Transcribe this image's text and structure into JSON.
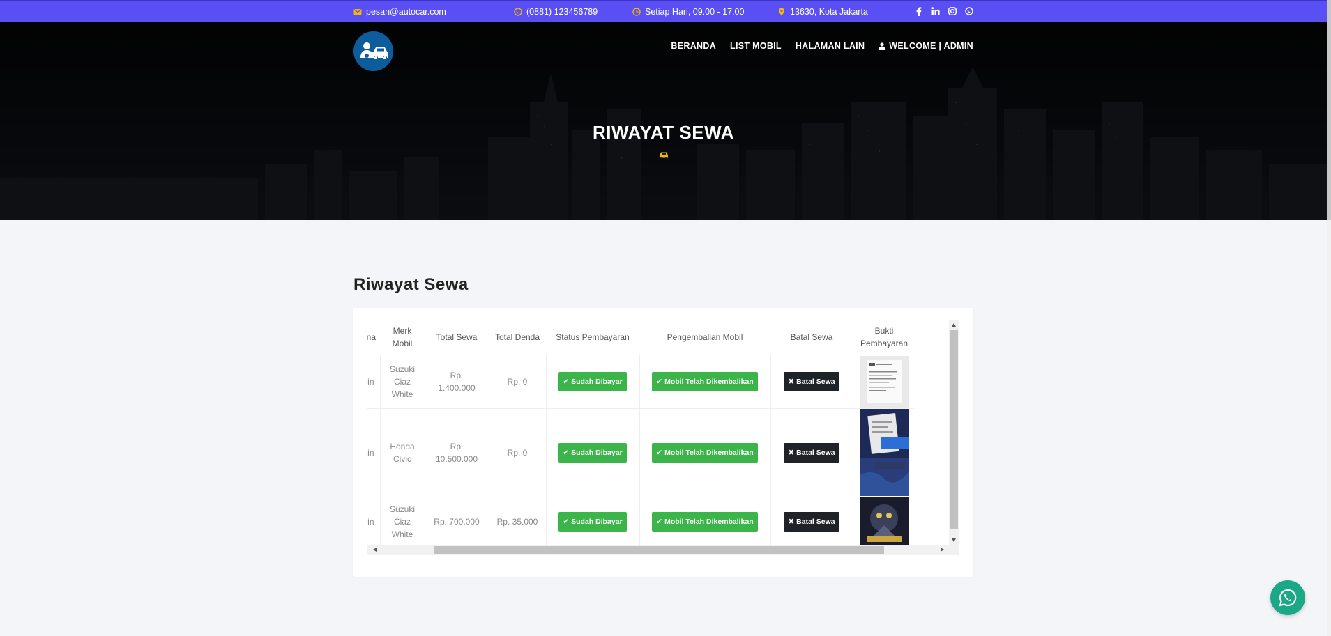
{
  "topbar": {
    "email": "pesan@autocar.com",
    "phone": "(0881) 123456789",
    "hours": "Setiap Hari, 09.00 - 17.00",
    "address": "13630, Kota Jakarta",
    "social": [
      "facebook-icon",
      "linkedin-icon",
      "instagram-icon",
      "whatsapp-icon"
    ]
  },
  "nav": {
    "items": [
      "BERANDA",
      "LIST MOBIL",
      "HALAMAN LAIN"
    ],
    "user": "WELCOME | ADMIN"
  },
  "hero": {
    "title": "RIWAYAT SEWA"
  },
  "main": {
    "title": "Riwayat Sewa",
    "table": {
      "headers": [
        "na",
        "Merk Mobil",
        "Total Sewa",
        "Total Denda",
        "Status Pembayaran",
        "Pengembalian Mobil",
        "Batal Sewa",
        "Bukti Pembayaran"
      ],
      "rows": [
        {
          "nama": "nin",
          "merk": "Suzuki Ciaz White",
          "total_sewa": "Rp. 1.400.000",
          "total_denda": "Rp. 0",
          "status": "Sudah Dibayar",
          "pengembalian": "Mobil Telah Dikembalikan",
          "batal": "Batal Sewa"
        },
        {
          "nama": "nin",
          "merk": "Honda Civic",
          "total_sewa": "Rp. 10.500.000",
          "total_denda": "Rp. 0",
          "status": "Sudah Dibayar",
          "pengembalian": "Mobil Telah Dikembalikan",
          "batal": "Batal Sewa"
        },
        {
          "nama": "nin",
          "merk": "Suzuki Ciaz White",
          "total_sewa": "Rp. 700.000",
          "total_denda": "Rp. 35.000",
          "status": "Sudah Dibayar",
          "pengembalian": "Mobil Telah Dikembalikan",
          "batal": "Batal Sewa"
        }
      ]
    }
  },
  "colors": {
    "topbar": "#5a4ff2",
    "success": "#3bb54a",
    "dark": "#1f2328",
    "logo": "#0d5c9c",
    "whatsapp": "#1ba887",
    "accent": "#f5b800"
  }
}
